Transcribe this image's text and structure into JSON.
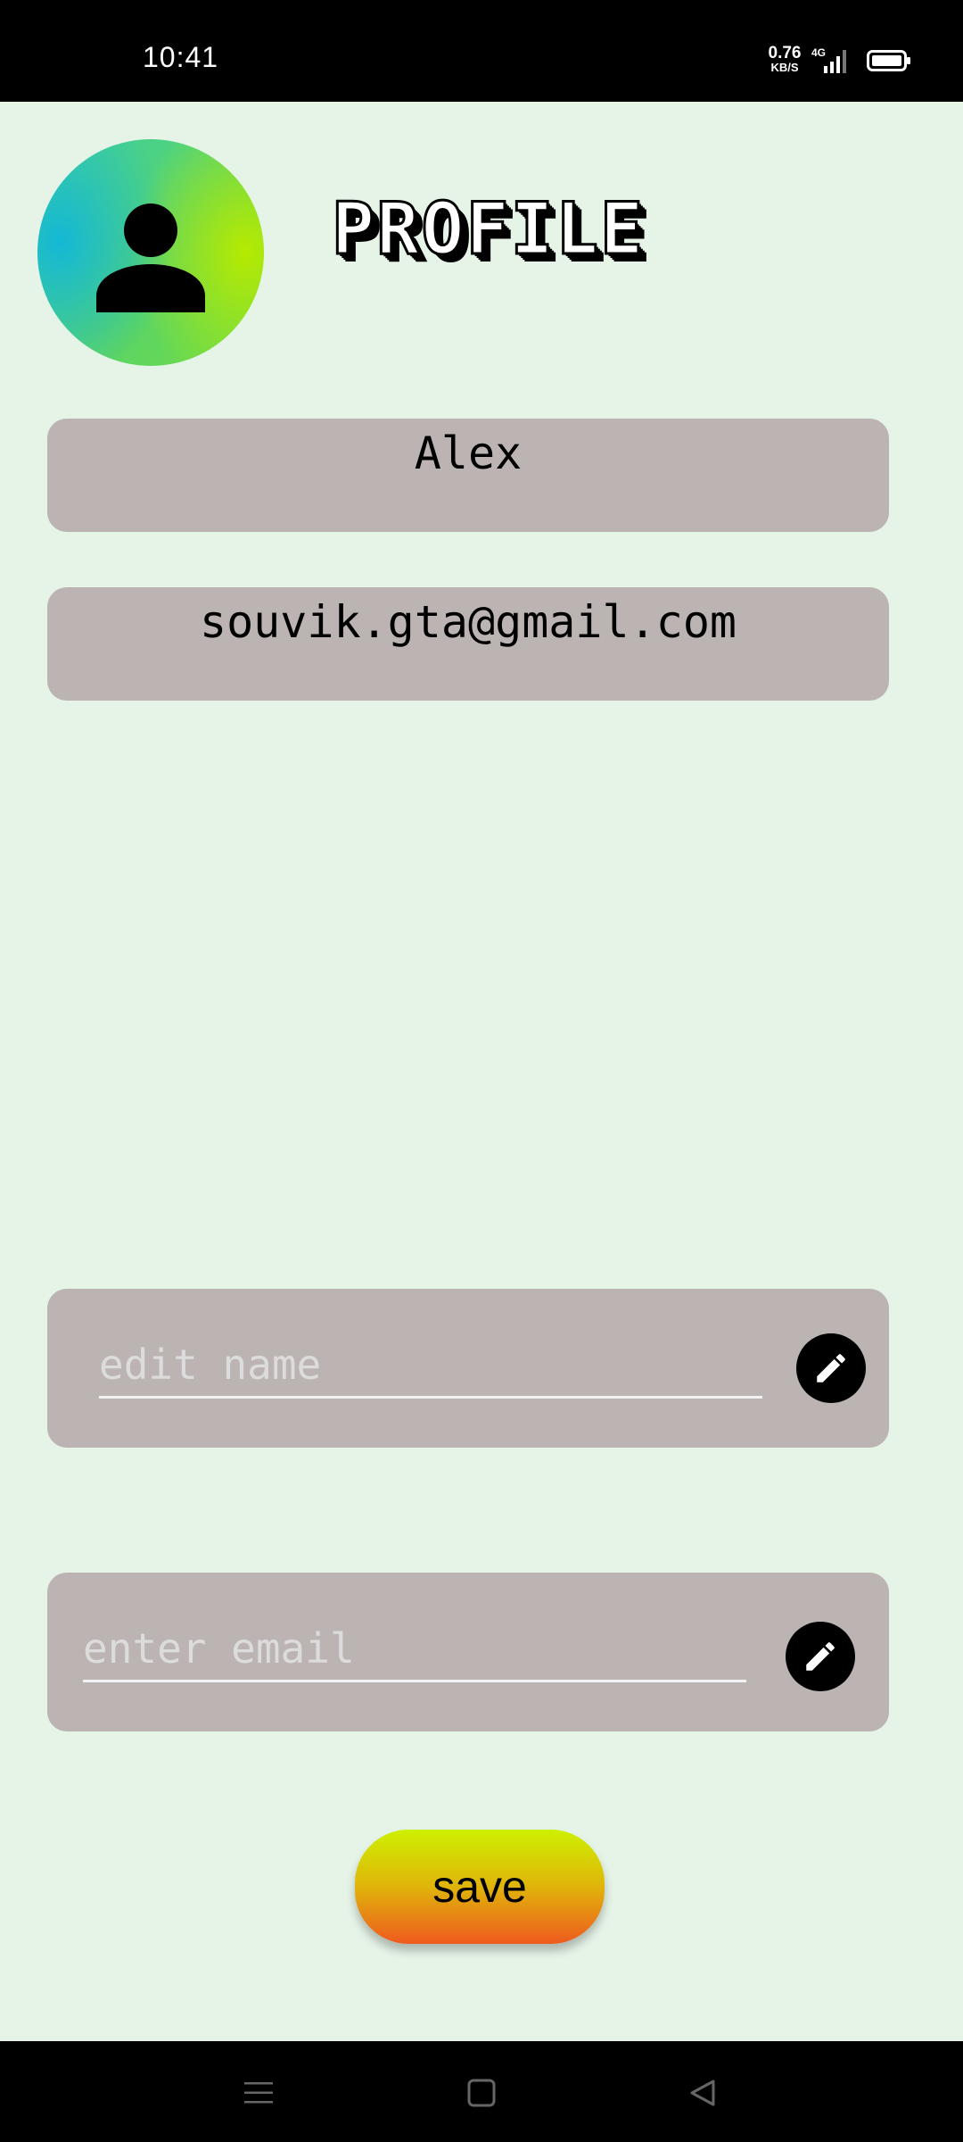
{
  "status_bar": {
    "time": "10:41",
    "net_speed_value": "0.76",
    "net_speed_unit": "KB/S",
    "network_type": "4G",
    "icons": [
      "signal-icon",
      "battery-icon"
    ]
  },
  "header": {
    "title": "PROFILE",
    "avatar_icon": "person-icon"
  },
  "profile": {
    "name": "Alex",
    "email": "souvik.gta@gmail.com"
  },
  "edit_name": {
    "placeholder": "edit name",
    "value": "",
    "button_icon": "pencil-icon"
  },
  "edit_email": {
    "placeholder": "enter email",
    "value": "",
    "button_icon": "pencil-icon"
  },
  "save_button": {
    "label": "save"
  },
  "nav_bar": {
    "items": [
      "menu-icon",
      "home-icon",
      "back-icon"
    ]
  },
  "colors": {
    "background": "#e6f4e8",
    "card": "#bcb3b3",
    "save_gradient_top": "#cdf000",
    "save_gradient_bottom": "#ee5a1e"
  }
}
